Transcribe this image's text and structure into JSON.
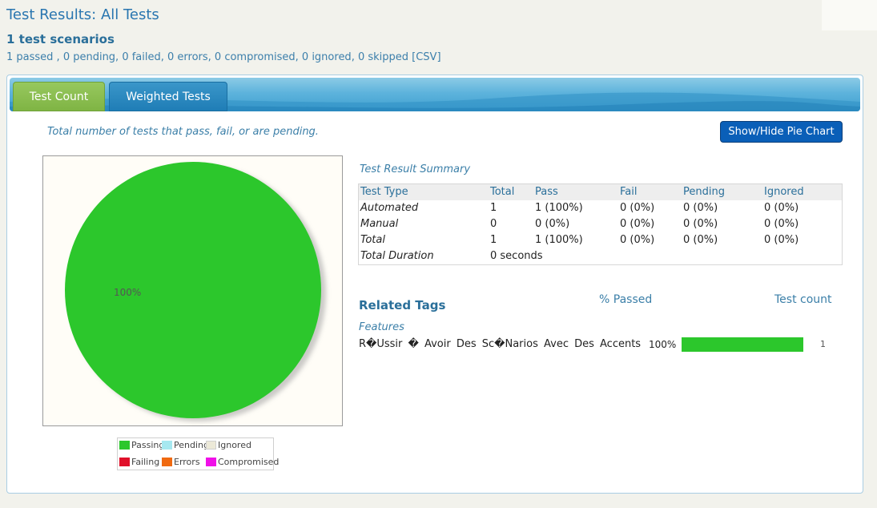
{
  "header": {
    "title": "Test Results: All Tests",
    "scenario_count": "1 test scenarios",
    "summary": "1 passed , 0 pending, 0 failed, 0 errors, 0 compromised, 0 ignored, 0 skipped [CSV]"
  },
  "tabs": [
    {
      "label": "Test Count",
      "active": true
    },
    {
      "label": "Weighted Tests",
      "active": false
    }
  ],
  "chart": {
    "caption": "Total number of tests that pass, fail, or are pending.",
    "toggle_button": "Show/Hide Pie Chart",
    "slice_label": "100%"
  },
  "chart_data": {
    "type": "pie",
    "categories": [
      "Passing",
      "Pending",
      "Ignored",
      "Failing",
      "Errors",
      "Compromised"
    ],
    "values": [
      1,
      0,
      0,
      0,
      0,
      0
    ],
    "colors": [
      "#2cc72c",
      "#a6e8f0",
      "#ece9d8",
      "#e0102a",
      "#f06a10",
      "#f010e8"
    ],
    "title": "",
    "legend": "bottom"
  },
  "legend": [
    {
      "label": "Passing",
      "color": "#2cc72c"
    },
    {
      "label": "Pending",
      "color": "#a6e8f0"
    },
    {
      "label": "Ignored",
      "color": "#ece9d8"
    },
    {
      "label": "Failing",
      "color": "#e0102a"
    },
    {
      "label": "Errors",
      "color": "#f06a10"
    },
    {
      "label": "Compromised",
      "color": "#f010e8"
    }
  ],
  "summary": {
    "caption": "Test Result Summary",
    "columns": [
      "Test Type",
      "Total",
      "Pass",
      "Fail",
      "Pending",
      "Ignored"
    ],
    "rows": [
      [
        "Automated",
        "1",
        "1 (100%)",
        "0 (0%)",
        "0 (0%)",
        "0 (0%)"
      ],
      [
        "Manual",
        "0",
        "0 (0%)",
        "0 (0%)",
        "0 (0%)",
        "0 (0%)"
      ],
      [
        "Total",
        "1",
        "1 (100%)",
        "0 (0%)",
        "0 (0%)",
        "0 (0%)"
      ]
    ],
    "duration_label": "Total Duration",
    "duration_value": "0 seconds"
  },
  "tags": {
    "title": "Related Tags",
    "passed_header": "% Passed",
    "count_header": "Test count",
    "group_label": "Features",
    "items": [
      {
        "name": "R�Ussir � Avoir Des Sc�Narios Avec Des Accents",
        "percent": "100%",
        "pass_fraction": 1.0,
        "count": "1"
      }
    ]
  }
}
